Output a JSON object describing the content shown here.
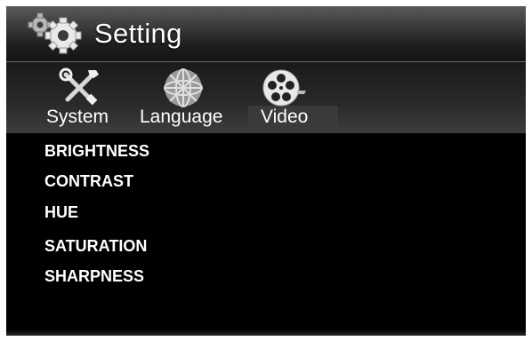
{
  "title": "Setting",
  "tabs": [
    {
      "label": "System",
      "icon": "tools-icon"
    },
    {
      "label": "Language",
      "icon": "globe-icon"
    },
    {
      "label": "Video",
      "icon": "film-reel-icon",
      "selected": true
    }
  ],
  "items": [
    "BRIGHTNESS",
    "CONTRAST",
    "HUE",
    "SATURATION",
    "SHARPNESS"
  ],
  "colors": {
    "background": "#000000",
    "text": "#ffffff",
    "selected_tab": "#3a3a3a"
  }
}
